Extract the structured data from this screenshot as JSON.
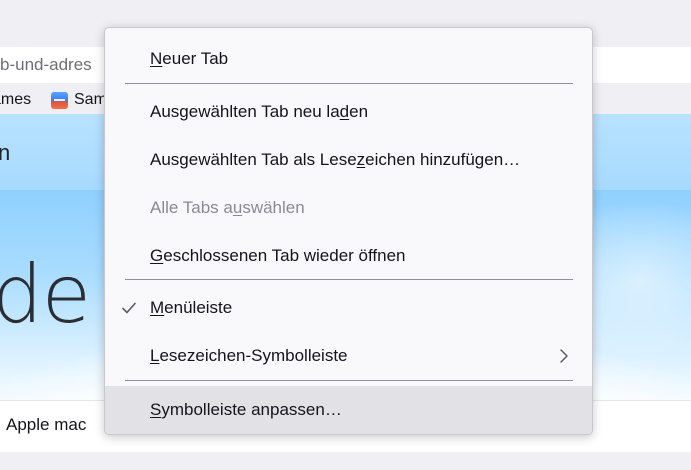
{
  "browser": {
    "url_fragment": "b-und-adres",
    "bookmarks": [
      {
        "label": "ames"
      },
      {
        "label": "Sam"
      }
    ]
  },
  "page": {
    "header_text": "n",
    "hero_text": "de",
    "bottom_text": "Apple mac"
  },
  "context_menu": {
    "items": [
      {
        "pre": "",
        "accel": "N",
        "post": "euer Tab",
        "disabled": false
      },
      {
        "pre": "Ausgewählten Tab neu la",
        "accel": "d",
        "post": "en",
        "disabled": false
      },
      {
        "pre": "Ausgewählten Tab als Lese",
        "accel": "z",
        "post": "eichen hinzufügen…",
        "disabled": false
      },
      {
        "pre": "Alle Tabs a",
        "accel": "u",
        "post": "swählen",
        "disabled": true
      },
      {
        "pre": "",
        "accel": "G",
        "post": "eschlossenen Tab wieder öffnen",
        "disabled": false
      },
      {
        "pre": "",
        "accel": "M",
        "post": "enüleiste",
        "disabled": false,
        "checked": true
      },
      {
        "pre": "",
        "accel": "L",
        "post": "esezeichen-Symbolleiste",
        "disabled": false,
        "submenu": true
      },
      {
        "pre": "",
        "accel": "S",
        "post": "ymbolleiste anpassen…",
        "disabled": false,
        "hovered": true
      }
    ]
  },
  "colors": {
    "menu_bg": "#f9f9fb",
    "hover_bg": "#e2e2e6",
    "disabled_text": "#8a8a92",
    "separator": "#8f8f9d"
  },
  "icons": {
    "check": "check-icon",
    "submenu": "chevron-right-icon"
  }
}
